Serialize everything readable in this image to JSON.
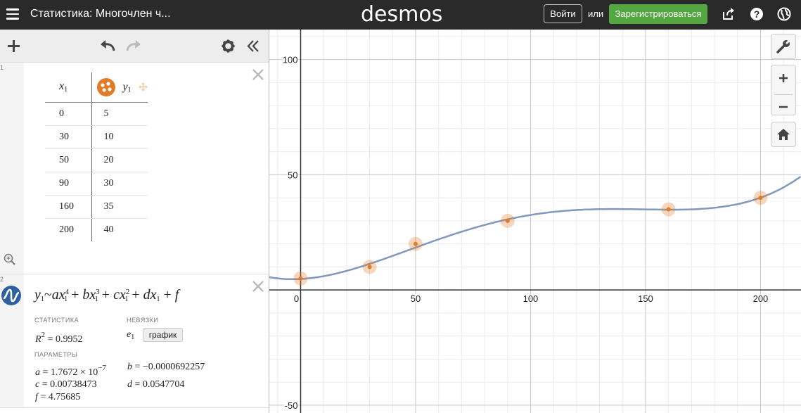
{
  "header": {
    "title": "Статистика: Многочлен ч...",
    "logo": "desmos",
    "login_label": "Войти",
    "or_label": "или",
    "signup_label": "Зарегистрироваться",
    "icons": [
      "menu-icon",
      "share-icon",
      "help-icon",
      "globe-icon"
    ]
  },
  "toolbar": {
    "icons": [
      "add-icon",
      "undo-icon",
      "redo-icon",
      "settings-icon",
      "collapse-icon"
    ]
  },
  "expressions": {
    "table": {
      "number": "1",
      "col1_var": "x",
      "col1_sub": "1",
      "col2_var": "y",
      "col2_sub": "1",
      "rows": [
        [
          "0",
          "5"
        ],
        [
          "30",
          "10"
        ],
        [
          "50",
          "20"
        ],
        [
          "90",
          "30"
        ],
        [
          "160",
          "35"
        ],
        [
          "200",
          "40"
        ]
      ]
    },
    "regression": {
      "number": "2",
      "stats_label": "СТАТИСТИКА",
      "residuals_label": "НЕВЯЗКИ",
      "r2_value": "0.9952",
      "residual_var": "e",
      "residual_sub": "1",
      "plot_label": "график",
      "params_label": "ПАРАМЕТРЫ",
      "a_mantissa": "1.7672",
      "a_exp": "−7",
      "b_value": "−0.0000692257",
      "c_value": "0.00738473",
      "d_value": "0.0547704",
      "f_value": "4.75685"
    }
  },
  "graph": {
    "x_ticks": [
      "0",
      "50",
      "100",
      "150",
      "200"
    ],
    "y_ticks": [
      "100",
      "50",
      "-50"
    ],
    "curve_color": "#7f98bc",
    "point_color": "#e07b28",
    "points": [
      [
        0,
        5
      ],
      [
        30,
        10
      ],
      [
        50,
        20
      ],
      [
        90,
        30
      ],
      [
        160,
        35
      ],
      [
        200,
        40
      ]
    ],
    "coefficients": {
      "a": 1.7672e-07,
      "b": -6.92257e-05,
      "c": 0.00738473,
      "d": 0.0547704,
      "f": 4.75685
    },
    "x_range": [
      -13.6,
      217.6
    ],
    "y_range": [
      -53.4,
      113.0
    ],
    "controls": [
      "wrench-icon",
      "zoom-in-icon",
      "zoom-out-icon",
      "home-icon"
    ]
  }
}
